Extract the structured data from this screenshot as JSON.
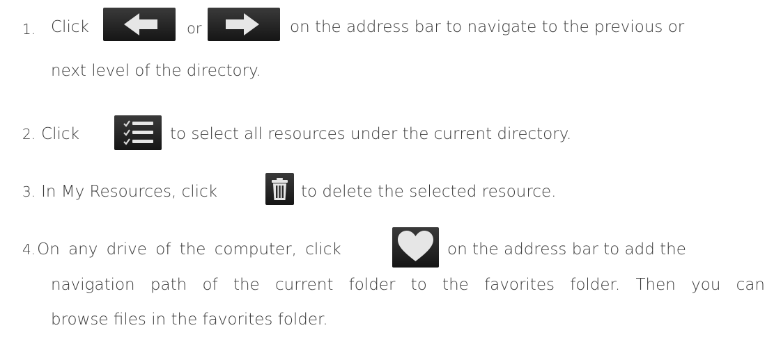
{
  "items": [
    {
      "number": "1.",
      "click": "Click",
      "or": "or",
      "rest": "on the address bar to navigate to the previous or",
      "cont": "next level of the directory.",
      "icons": [
        "arrow-left-icon",
        "arrow-right-icon"
      ]
    },
    {
      "number": "2.",
      "click": "Click",
      "rest": "to select all resources under the current directory.",
      "icons": [
        "select-all-list-icon"
      ]
    },
    {
      "number": "3.",
      "lead": "In My Resources, click",
      "rest": "to delete the selected resource.",
      "icons": [
        "trash-icon"
      ]
    },
    {
      "number": "4.",
      "lead": "On any drive of the computer, click",
      "rest": "on the address bar to add the",
      "cont1": "navigation path of the current folder to the favorites folder. Then you can",
      "cont2": "browse files in the favorites folder.",
      "icons": [
        "heart-icon"
      ]
    }
  ],
  "colors": {
    "text": "#3a3a3a",
    "button_dark": "#1e1e1e",
    "icon_light": "#e6e6e6"
  }
}
